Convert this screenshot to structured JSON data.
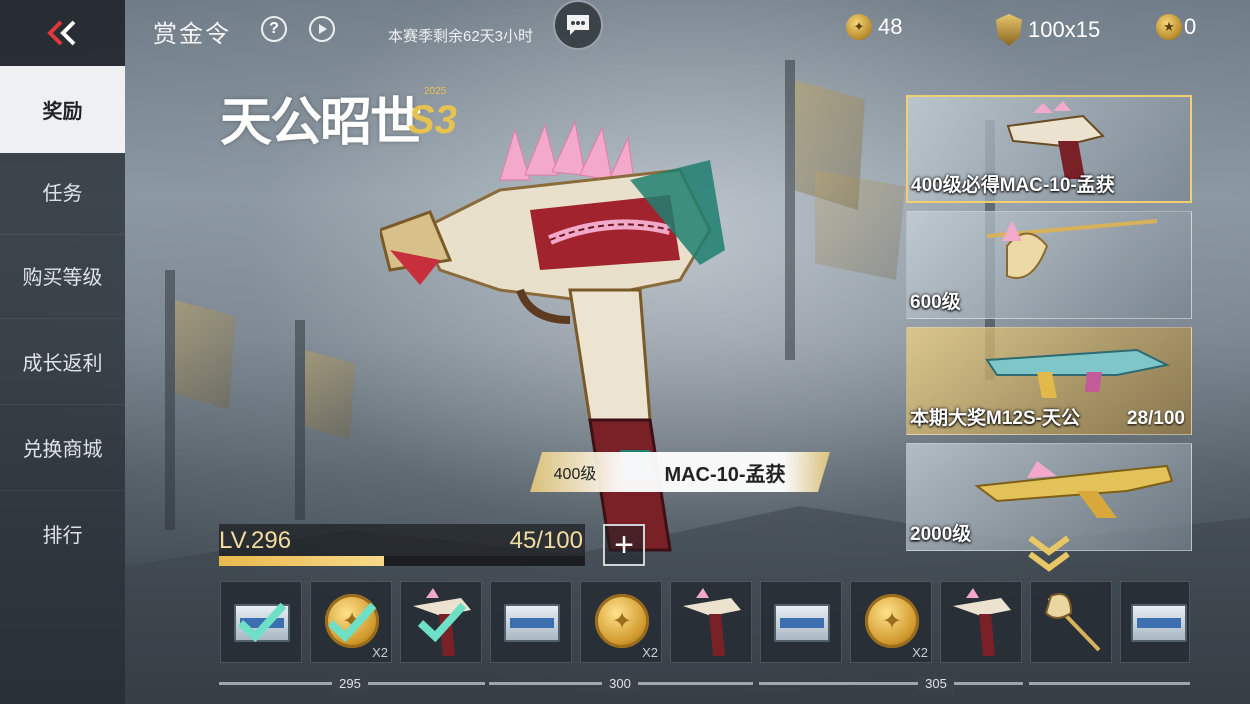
{
  "header": {
    "title": "赏金令",
    "help_icon": "?",
    "season_remaining": "本赛季剩余62天3小时",
    "currencies": [
      {
        "icon": "gold-coin-icon",
        "value": "48"
      },
      {
        "icon": "gold-shield-icon",
        "value": "100x15"
      },
      {
        "icon": "coin-star-icon",
        "value": "0"
      }
    ]
  },
  "sidebar": {
    "items": [
      {
        "label": "奖励",
        "active": true
      },
      {
        "label": "任务"
      },
      {
        "label": "购买等级"
      },
      {
        "label": "成长返利"
      },
      {
        "label": "兑换商城"
      },
      {
        "label": "排行"
      }
    ]
  },
  "season_logo": {
    "text": "天公昭世",
    "season": "S3",
    "year": "2025"
  },
  "featured": {
    "level": "400级",
    "name": "MAC-10-孟获"
  },
  "level": {
    "label": "LV.296",
    "progress_text": "45/100",
    "progress": 0.45
  },
  "plus_label": "+",
  "cards": [
    {
      "label": "400级必得MAC-10-孟获",
      "selected": true
    },
    {
      "label": "600级"
    },
    {
      "label": "本期大奖M12S-天公",
      "progress": "28/100"
    },
    {
      "label": "2000级"
    }
  ],
  "rewards": [
    {
      "type": "crate",
      "claimed": true
    },
    {
      "type": "coin",
      "claimed": true,
      "qty": "X2"
    },
    {
      "type": "gun",
      "claimed": true
    },
    {
      "type": "crate"
    },
    {
      "type": "coin",
      "qty": "X2"
    },
    {
      "type": "gun"
    },
    {
      "type": "crate"
    },
    {
      "type": "coin",
      "qty": "X2"
    },
    {
      "type": "gun"
    },
    {
      "type": "axe"
    },
    {
      "type": "crate"
    }
  ],
  "level_markers": [
    "295",
    "300",
    "305"
  ],
  "colors": {
    "accent_gold": "#f1cf73",
    "back_red": "#e0373b",
    "progress_fill": "#e9b94c"
  }
}
